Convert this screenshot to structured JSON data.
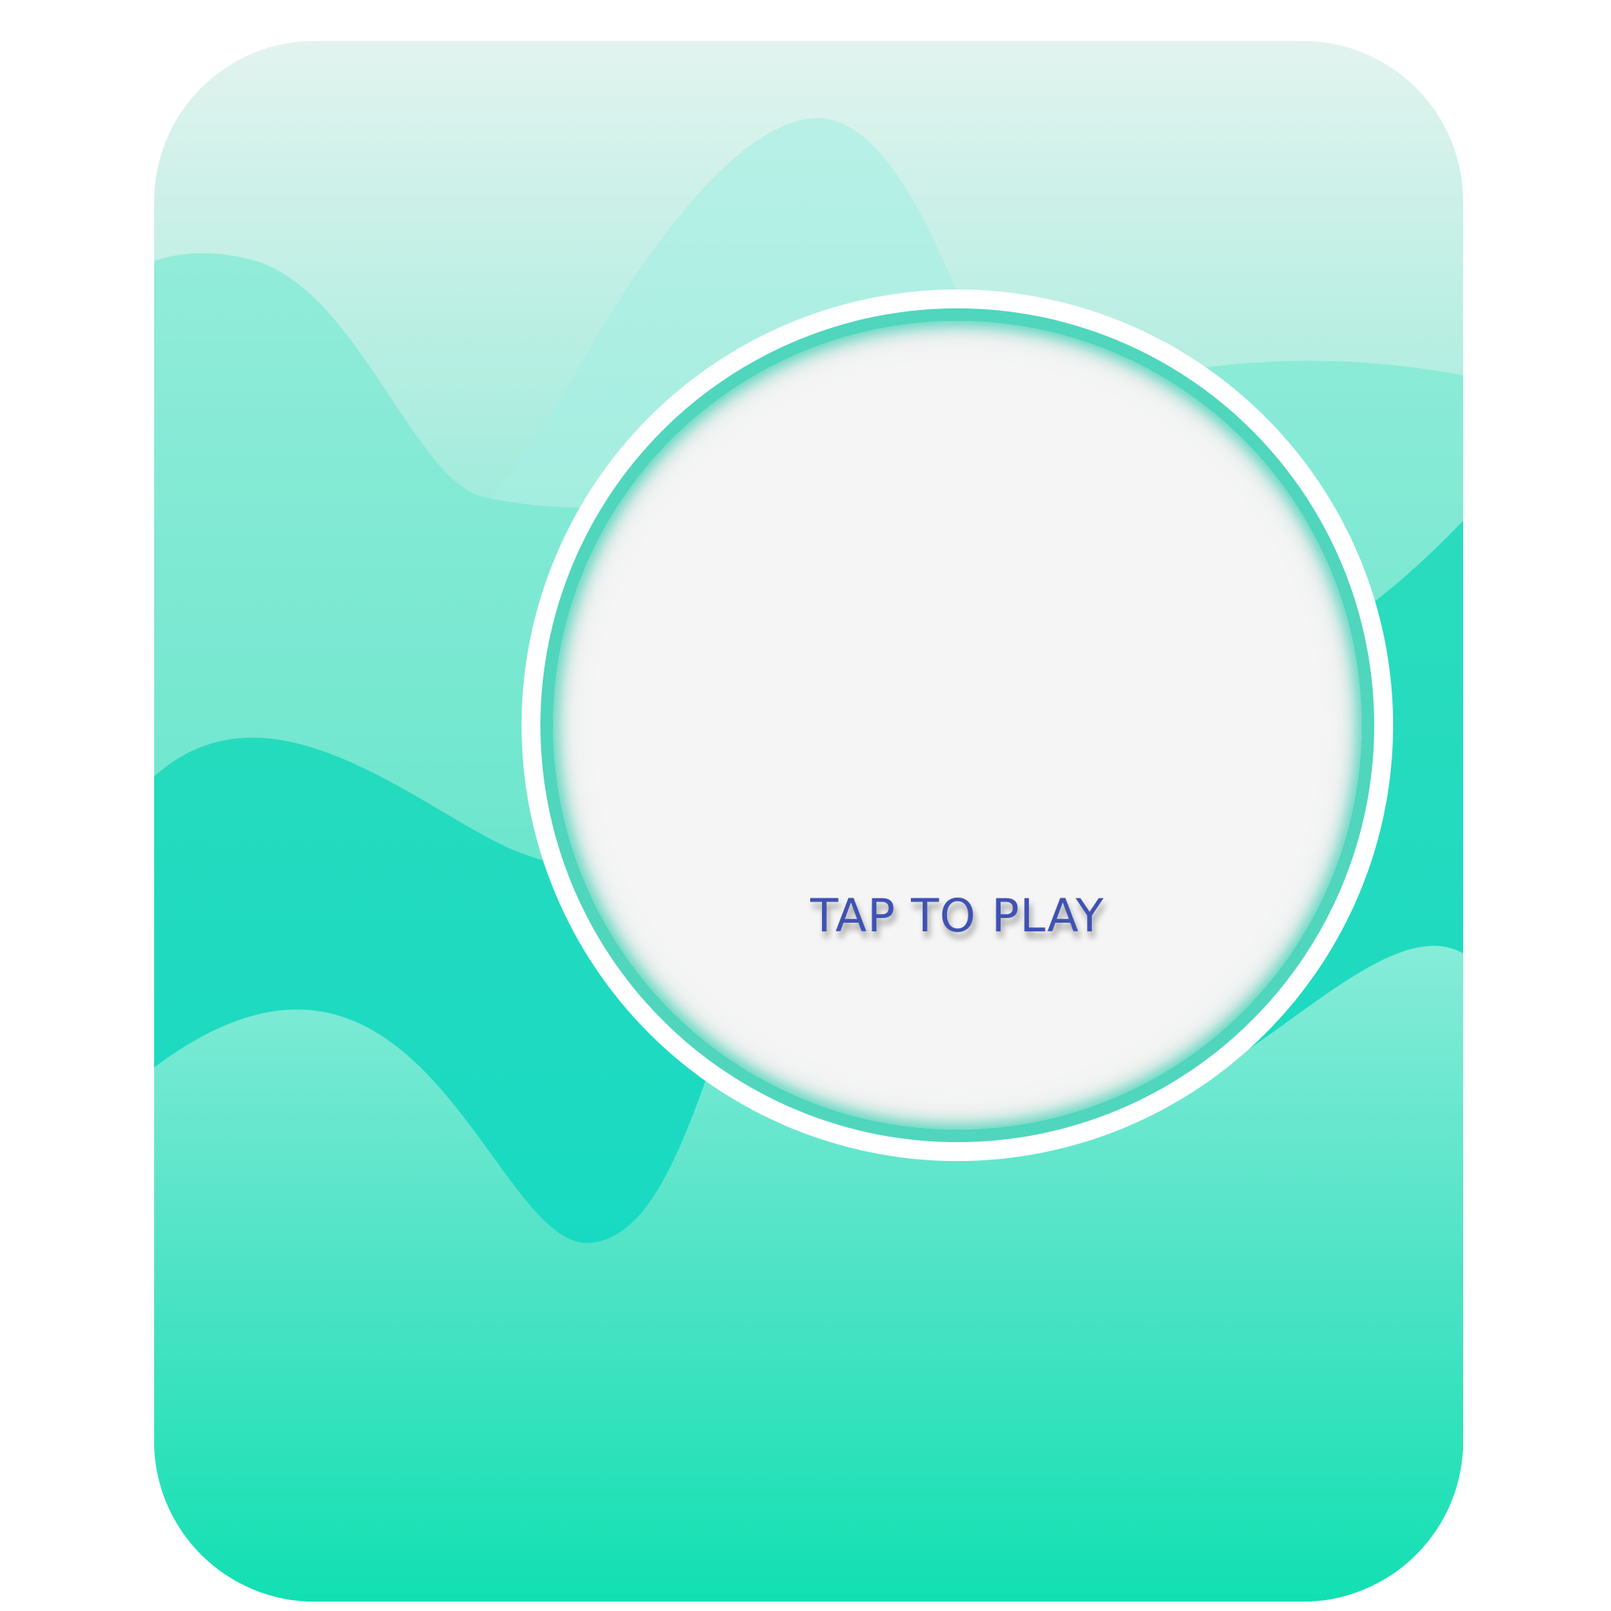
{
  "play_prompt": {
    "label": "TAP TO PLAY"
  },
  "colors": {
    "page_background": "#ffffff",
    "card_top": "#e2f3ef",
    "card_bottom": "#0fe0b1",
    "ring_white": "#ffffff",
    "ring_teal": "#4fd6bd",
    "disc_fill": "#f5f5f5",
    "label_text": "#3f52b3"
  }
}
